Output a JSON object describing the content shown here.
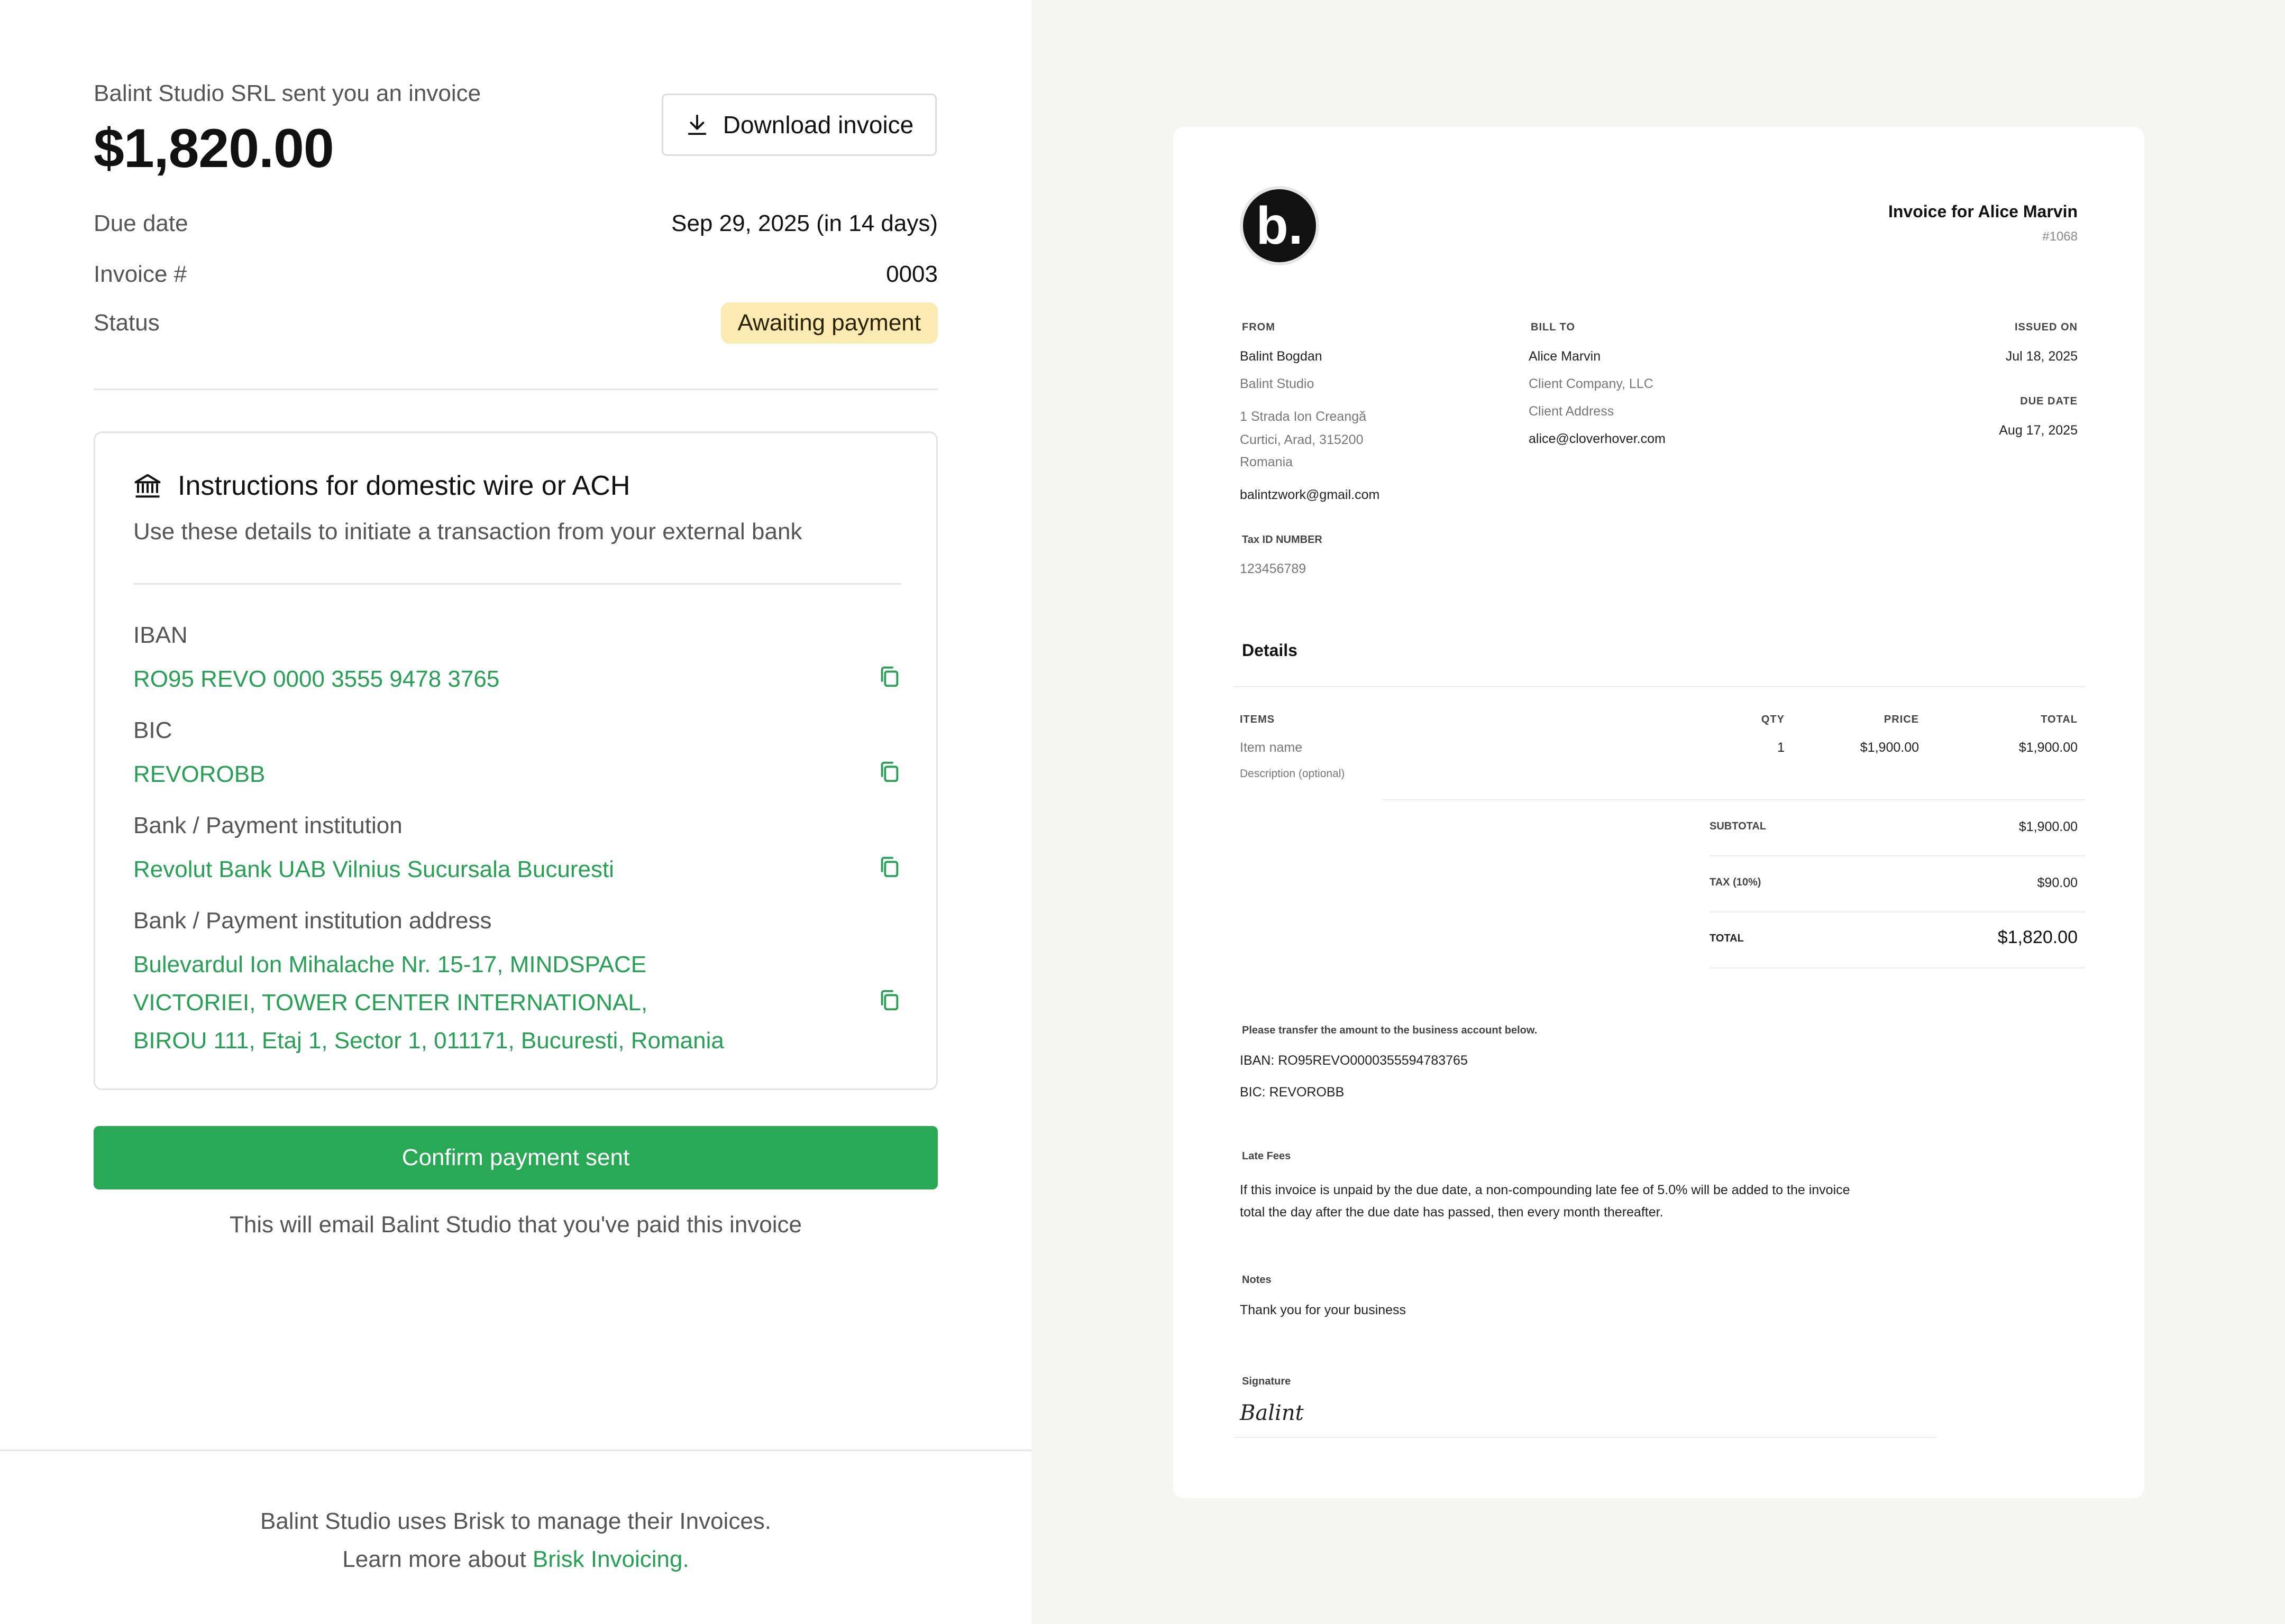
{
  "header": {
    "sender_line": "Balint Studio SRL sent you an invoice",
    "amount": "$1,820.00",
    "download_label": "Download invoice"
  },
  "meta": {
    "due_date_label": "Due date",
    "due_date_value": "Sep 29, 2025 (in 14 days)",
    "invoice_label": "Invoice #",
    "invoice_value": "0003",
    "status_label": "Status",
    "status_value": "Awaiting payment",
    "status_color": "#fbeab1"
  },
  "instructions": {
    "title": "Instructions for domestic wire or ACH",
    "subtitle": "Use these details to initiate a transaction from your external bank",
    "fields": [
      {
        "label": "IBAN",
        "value": "RO95 REVO 0000 3555 9478 3765"
      },
      {
        "label": "BIC",
        "value": "REVOROBB"
      },
      {
        "label": "Bank / Payment institution",
        "value": "Revolut Bank UAB Vilnius Sucursala Bucuresti"
      },
      {
        "label": "Bank / Payment institution address",
        "value": "Bulevardul Ion Mihalache Nr. 15-17, MINDSPACE VICTORIEI, TOWER CENTER INTERNATIONAL, BIROU 111, Etaj 1, Sector 1, 011171, Bucuresti, Romania"
      }
    ],
    "accent_color": "#27a055"
  },
  "confirm": {
    "button_label": "Confirm payment sent",
    "note": "This will email Balint Studio that you've paid this invoice",
    "button_color": "#29a856"
  },
  "footer": {
    "line1": "Balint Studio uses Brisk to manage their Invoices.",
    "line2_prefix": "Learn more about",
    "link_label": "Brisk Invoicing."
  },
  "invoice_doc": {
    "logo_letter": "b.",
    "title": "Invoice for Alice Marvin",
    "number": "#1068",
    "from": {
      "caption": "FROM",
      "name": "Balint Bogdan",
      "company": "Balint Studio",
      "address1": "1 Strada Ion Creangă",
      "address2": "Curtici, Arad, 315200",
      "address3": "Romania",
      "email": "balintzwork@gmail.com",
      "tax_caption": "Tax ID NUMBER",
      "tax_id": "123456789"
    },
    "bill_to": {
      "caption": "BILL TO",
      "name": "Alice Marvin",
      "company": "Client Company, LLC",
      "address": "Client Address",
      "email": "alice@cloverhover.com"
    },
    "dates": {
      "issued_caption": "ISSUED ON",
      "issued": "Jul 18, 2025",
      "due_caption": "DUE DATE",
      "due": "Aug 17, 2025"
    },
    "details_title": "Details",
    "table_headers": {
      "items": "ITEMS",
      "qty": "QTY",
      "price": "PRICE",
      "total": "TOTAL"
    },
    "items": [
      {
        "name": "Item name",
        "description": "Description (optional)",
        "qty": "1",
        "price": "$1,900.00",
        "total": "$1,900.00"
      }
    ],
    "subtotal_label": "SUBTOTAL",
    "subtotal": "$1,900.00",
    "tax_label": "TAX (10%)",
    "tax": "$90.00",
    "total_label": "TOTAL",
    "total": "$1,820.00",
    "transfer_caption": "Please transfer the amount to the business account below.",
    "iban_line": "IBAN: RO95REVO0000355594783765",
    "bic_line": "BIC: REVOROBB",
    "late_fees_caption": "Late Fees",
    "late_fees_text": "If this invoice is unpaid by the due date, a non-compounding late fee of 5.0% will be added to the invoice total the day after the due date has passed, then every month thereafter.",
    "notes_caption": "Notes",
    "notes_text": "Thank you for your business",
    "signature_caption": "Signature",
    "signature": "Balint"
  }
}
